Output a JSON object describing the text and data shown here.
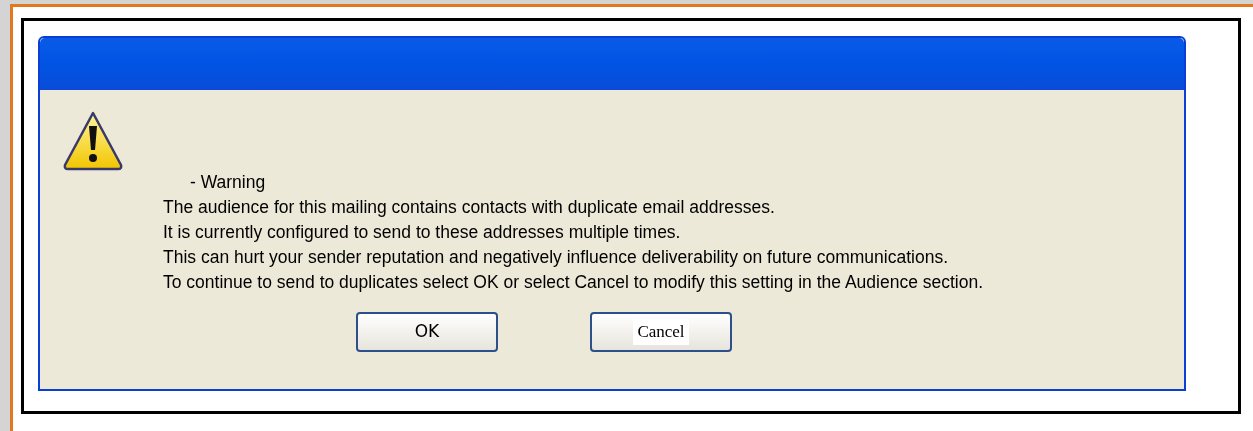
{
  "dialog": {
    "heading": "- Warning",
    "lines": [
      "The audience for this mailing contains contacts with duplicate email addresses.",
      "It is currently configured to send to these addresses multiple times.",
      "This can hurt your sender reputation and negatively influence deliverability on future communications.",
      "To continue to send to duplicates select OK or select Cancel to modify this setting in the Audience section."
    ],
    "buttons": [
      {
        "label": "OK",
        "kind": "ok"
      },
      {
        "label": "Cancel",
        "kind": "cancel"
      }
    ]
  }
}
